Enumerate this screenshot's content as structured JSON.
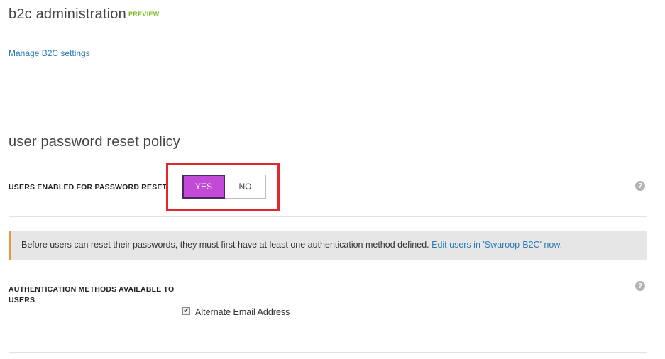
{
  "header": {
    "title": "b2c administration",
    "badge": "PREVIEW"
  },
  "links": {
    "manage_b2c": "Manage B2C settings"
  },
  "policy": {
    "section_title": "user password reset policy",
    "enabled_label": "USERS ENABLED FOR PASSWORD RESET",
    "toggle": {
      "yes_label": "YES",
      "no_label": "NO",
      "selected": "YES"
    },
    "help_glyph": "?"
  },
  "banner": {
    "text": "Before users can reset their passwords, they must first have at least one authentication method defined.",
    "link_text": "Edit users in 'Swaroop-B2C' now.",
    "accent_color": "#e8963c"
  },
  "auth_methods": {
    "label_line1": "AUTHENTICATION METHODS AVAILABLE TO",
    "label_line2": "USERS",
    "options": [
      {
        "label": "Alternate Email Address",
        "checked": true
      }
    ]
  },
  "colors": {
    "accent_blue": "#2b7bb9",
    "preview_green": "#7cba2c",
    "toggle_selected": "#c24ad6",
    "highlight_red": "#e0262e"
  },
  "icons": {
    "help": "help-icon",
    "checkmark": "checkmark-icon"
  }
}
